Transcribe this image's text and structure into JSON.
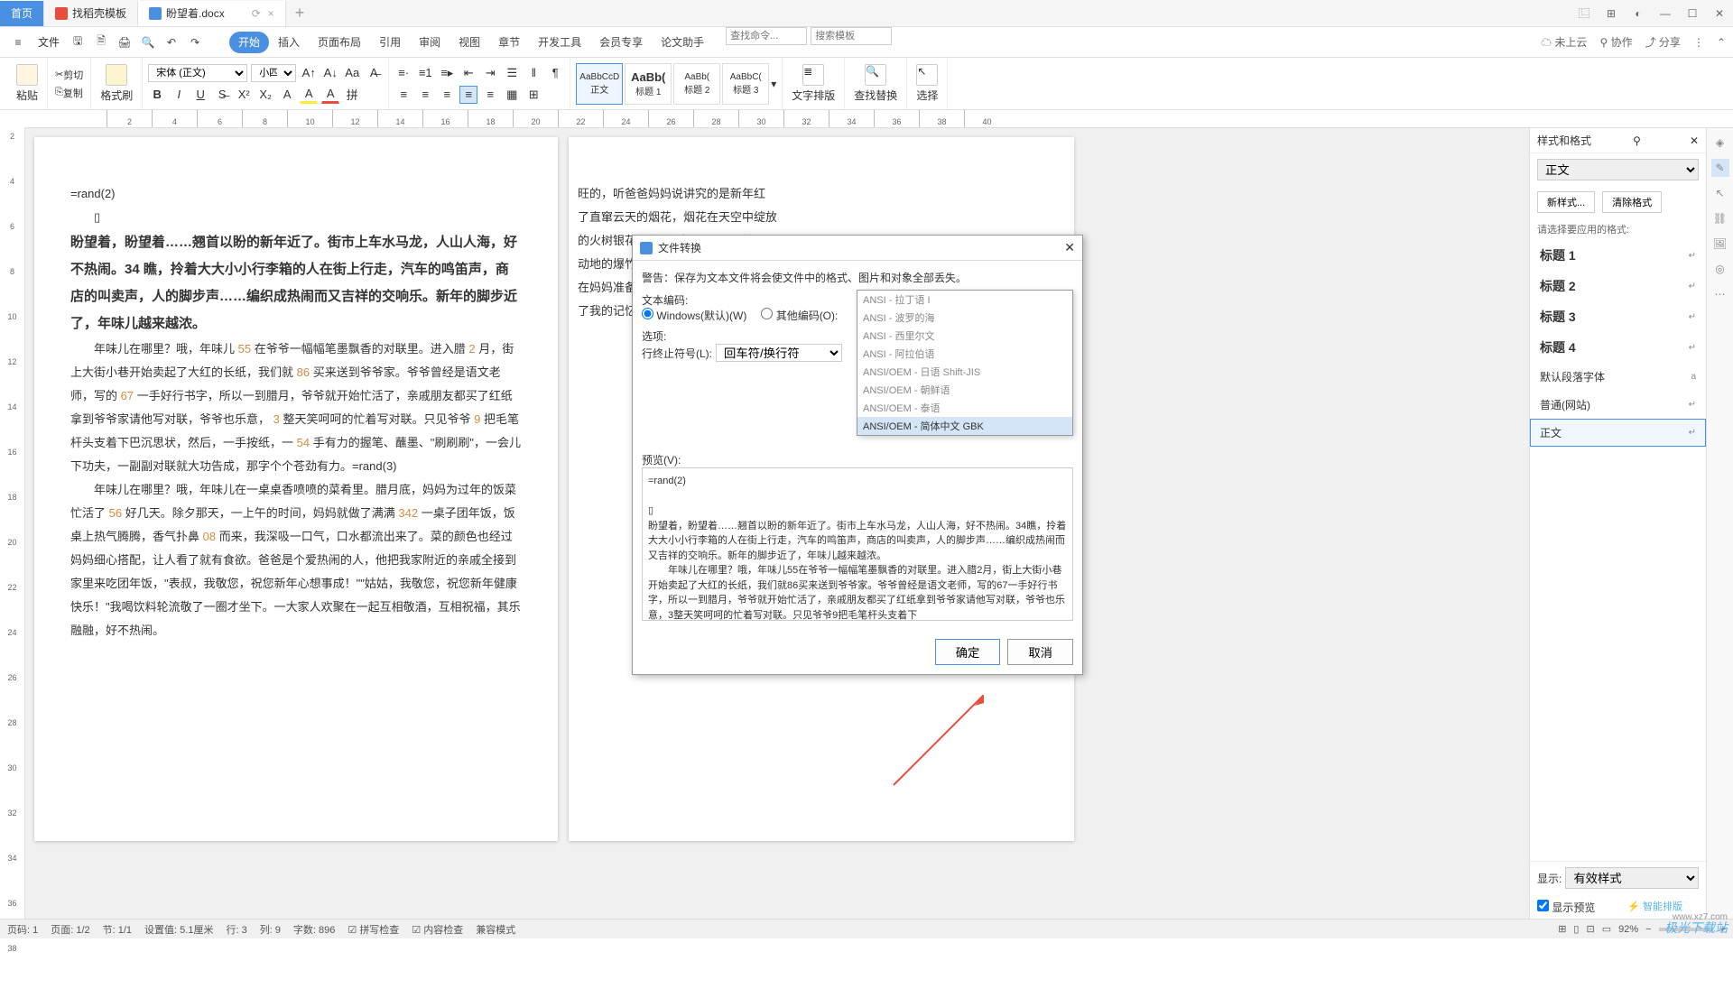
{
  "tabs": {
    "home": "首页",
    "template": "找稻壳模板",
    "doc": "盼望着.docx"
  },
  "menu": {
    "file": "文件",
    "start": "开始",
    "insert": "插入",
    "layout": "页面布局",
    "ref": "引用",
    "review": "审阅",
    "view": "视图",
    "chapter": "章节",
    "dev": "开发工具",
    "member": "会员专享",
    "thesis": "论文助手",
    "search_cmd": "查找命令...",
    "search_tpl": "搜索模板"
  },
  "menu_right": {
    "cloud": "未上云",
    "collab": "协作",
    "share": "分享"
  },
  "ribbon": {
    "paste": "粘贴",
    "cut": "剪切",
    "copy": "复制",
    "format_painter": "格式刷",
    "font": "宋体 (正文)",
    "size": "小四",
    "style_body": "正文",
    "style_h1": "标题 1",
    "style_h2": "标题 2",
    "style_h3": "标题 3",
    "layout": "文字排版",
    "find": "查找替换",
    "select": "选择"
  },
  "styles": {
    "s1": "AaBbCcD",
    "s2": "AaBb(",
    "s3": "AaBb(",
    "s4": "AaBbC("
  },
  "sidepanel": {
    "title": "样式和格式",
    "current": "正文",
    "newstyle": "新样式...",
    "clearfmt": "清除格式",
    "choose": "请选择要应用的格式:",
    "items": [
      "标题 1",
      "标题 2",
      "标题 3",
      "标题 4",
      "默认段落字体",
      "普通(网站)",
      "正文"
    ],
    "show": "显示:",
    "show_val": "有效样式",
    "preview": "显示预览"
  },
  "doc": {
    "rand": "=rand(2)",
    "p1_bold": "盼望着，盼望着……翘首以盼的新年近了。街市上车水马龙，人山人海，好不热闹。34 瞧，拎着大大小小行李箱的人在街上行走，汽车的鸣笛声，商店的叫卖声，人的脚步声……编织成热闹而又吉祥的交响乐。新年的脚步近了，年味儿越来越浓。",
    "p2a": "年味儿在哪里？哦，年味儿",
    "p2n1": "55",
    "p2b": "在爷爷一幅幅笔墨飘香的对联里。进入腊",
    "p2n2": "2",
    "p2c": "月，街上大街小巷开始卖起了大红的长纸，我们就",
    "p2n3": "86",
    "p2d": "买来送到爷爷家。爷爷曾经是语文老师，写的",
    "p2n4": "67",
    "p2e": "一手好行书字，所以一到腊月，爷爷就开始忙活了，亲戚朋友都买了红纸拿到爷爷家请他写对联，爷爷也乐意，",
    "p2n5": "3",
    "p2f": "整天笑呵呵的忙着写对联。只见爷爷",
    "p2n6": "9",
    "p2g": "把毛笔杆头支着下巴沉思状，然后，一手按纸，一",
    "p2n7": "54",
    "p2h": "手有力的握笔、蘸墨、\"刷刷刷\"，一会儿下功夫，一副副对联就大功告成，那字个个苍劲有力。=rand(3)",
    "p3a": "年味儿在哪里？哦，年味儿在一桌桌香喷喷的菜肴里。腊月底，妈妈为过年的饭菜忙活了",
    "p3n1": "56",
    "p3b": "好几天。除夕那天，一上午的时间，妈妈就做了满满",
    "p3n2": "342",
    "p3c": "一桌子团年饭，饭桌上热气腾腾，香气扑鼻",
    "p3n3": "08",
    "p3d": "而来，我深吸一口气，口水都流出来了。菜的颜色也经过妈妈细心搭配，让人看了就有食欲。爸爸是个爱热闹的人，他把我家附近的亲戚全接到家里来吃团年饭，\"表叔，我敬您，祝您新年心想事成！\"\"姑姑，我敬您，祝您新年健康快乐！\"我喝饮料轮流敬了一圈才坐下。一大家人欢聚在一起互相敬酒，互相祝福，其乐融融，好不热闹。",
    "pg2a": "旺的，听爸爸妈妈说讲究的是新年红",
    "pg2b": "了直窜云天的烟花，烟花在天空中绽放",
    "pg2c": "的火树银花。旋转\"地雷\"……\"爆竹",
    "pg2d": "动地的爆竹来憧憬新年的期待和喜悦。",
    "pg2e": "在妈妈准备的美味佳肴里，年味儿在",
    "pg2f": "了我的记忆里。"
  },
  "dialog": {
    "title": "文件转换",
    "warn": "警告：保存为文本文件将会使文件中的格式、图片和对象全部丢失。",
    "enc_label": "文本编码:",
    "win": "Windows(默认)(W)",
    "other": "其他编码(O):",
    "options": "选项:",
    "eol": "行终止符号(L):",
    "eol_val": "回车符/换行符",
    "preview": "预览(V):",
    "encodings": [
      "ANSI - 拉丁语 I",
      "ANSI - 波罗的海",
      "ANSI - 西里尔文",
      "ANSI - 阿拉伯语",
      "ANSI/OEM - 日语 Shift-JIS",
      "ANSI/OEM - 朝鲜语",
      "ANSI/OEM - 泰语",
      "ANSI/OEM - 简体中文 GBK"
    ],
    "ok": "确定",
    "cancel": "取消",
    "prev_rand": "=rand(2)",
    "prev_p1": "盼望着，盼望着……翘首以盼的新年近了。街市上车水马龙，人山人海，好不热闹。34瞧，拎着大大小小行李箱的人在街上行走，汽车的鸣笛声，商店的叫卖声，人的脚步声……编织成热闹而又吉祥的交响乐。新年的脚步近了，年味儿越来越浓。",
    "prev_p2": "　　年味儿在哪里？哦，年味儿55在爷爷一幅幅笔墨飘香的对联里。进入腊2月，街上大街小巷开始卖起了大红的长纸，我们就86买来送到爷爷家。爷爷曾经是语文老师，写的67一手好行书字，所以一到腊月，爷爷就开始忙活了，亲戚朋友都买了红纸拿到爷爷家请他写对联，爷爷也乐意，3整天笑呵呵的忙着写对联。只见爷爷9把毛笔杆头支着下"
  },
  "status": {
    "pageno": "页码: 1",
    "page": "页面: 1/2",
    "sec": "节: 1/1",
    "pos": "设置值: 5.1厘米",
    "line": "行: 3",
    "col": "列: 9",
    "words": "字数: 896",
    "spell": "拼写检查",
    "compat": "内容检查",
    "mode": "兼容模式",
    "zoom": "92%"
  },
  "smart": "智能排版",
  "wm": "极光下载站",
  "wm2": "www.xz7.com"
}
